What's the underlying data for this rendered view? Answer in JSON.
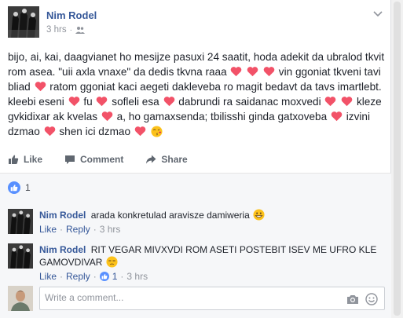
{
  "post": {
    "author": "Nim Rodel",
    "time": "3 hrs",
    "dot": "·",
    "text_segments": [
      "bijo, ai, kai, daagvianet ho mesijze pasuxi 24 saatit, hoda adekit da ubralod tkvit rom asea. \"uii axla vnaxe\" da dedis tkvna raaa",
      "vin ggoniat tkveni tavi bliad",
      "ratom ggoniat kaci aegeti dakleveba ro magit bedavt da tavs imartlebt. kleebi eseni",
      "fu",
      "sofleli esa",
      "dabrundi ra saidanac moxvedi",
      "kleze gvkidixar ak kvelas",
      "a, ho gamaxsenda; tbilisshi ginda gatxoveba",
      "izvini dzmao",
      "shen ici dzmao"
    ]
  },
  "actions": {
    "like": "Like",
    "comment": "Comment",
    "share": "Share"
  },
  "reactions": {
    "count": "1"
  },
  "comments": [
    {
      "author": "Nim Rodel",
      "text": "arada konkretulad aravisze damiweria",
      "like_label": "Like",
      "reply_label": "Reply",
      "time": "3 hrs",
      "sep": "·"
    },
    {
      "author": "Nim Rodel",
      "text": "RIT VEGAR MIVXVDI ROM ASETI POSTEBIT ISEV ME UFRO KLE GAMOVDIVAR",
      "like_label": "Like",
      "reply_label": "Reply",
      "likes": "1",
      "time": "3 hrs",
      "sep": "·"
    }
  ],
  "composer": {
    "placeholder": "Write a comment..."
  },
  "colors": {
    "link": "#365899",
    "heart": "#f25268",
    "like_blue": "#5890ff"
  }
}
